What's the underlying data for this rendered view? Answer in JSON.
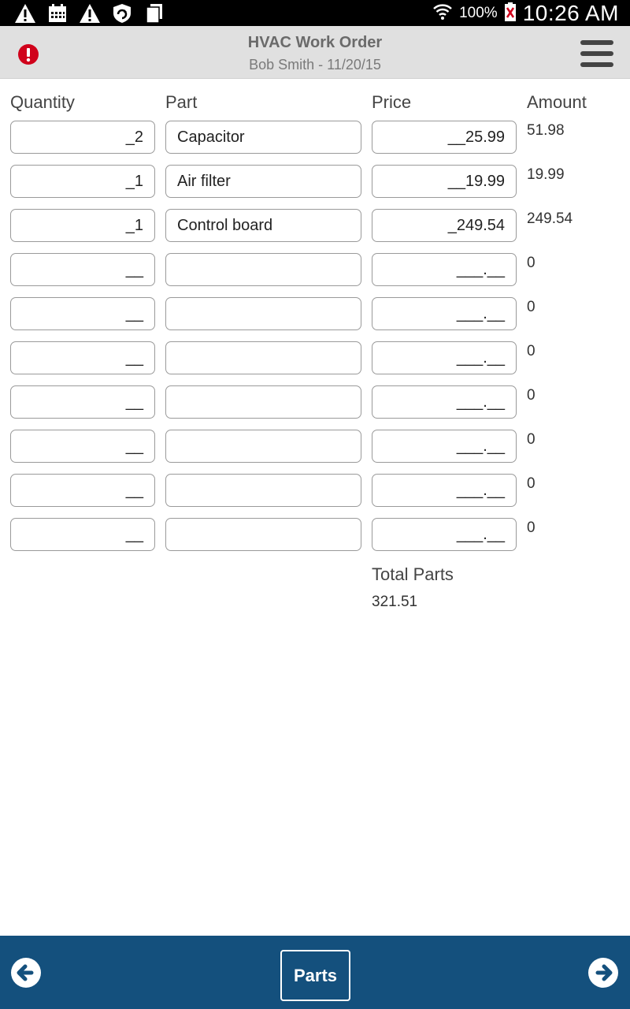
{
  "status_bar": {
    "icons": [
      "warning-icon",
      "calendar-icon",
      "warning-icon",
      "shield-icon",
      "files-icon"
    ],
    "wifi_icon": "wifi-icon",
    "battery_percent": "100%",
    "battery_icon": "battery-icon",
    "time": "10:26 AM"
  },
  "header": {
    "title": "HVAC Work Order",
    "subtitle": "Bob Smith - 11/20/15",
    "alert_icon": "alert-icon",
    "menu_icon": "hamburger-menu-icon"
  },
  "columns": {
    "quantity": "Quantity",
    "part": "Part",
    "price": "Price",
    "amount": "Amount"
  },
  "rows": [
    {
      "quantity": "_2",
      "part": "Capacitor",
      "price": "__25.99",
      "amount": "51.98"
    },
    {
      "quantity": "_1",
      "part": "Air filter",
      "price": "__19.99",
      "amount": "19.99"
    },
    {
      "quantity": "_1",
      "part": "Control board",
      "price": "_249.54",
      "amount": "249.54"
    },
    {
      "quantity": "__",
      "part": "",
      "price": "___.__",
      "amount": "0"
    },
    {
      "quantity": "__",
      "part": "",
      "price": "___.__",
      "amount": "0"
    },
    {
      "quantity": "__",
      "part": "",
      "price": "___.__",
      "amount": "0"
    },
    {
      "quantity": "__",
      "part": "",
      "price": "___.__",
      "amount": "0"
    },
    {
      "quantity": "__",
      "part": "",
      "price": "___.__",
      "amount": "0"
    },
    {
      "quantity": "__",
      "part": "",
      "price": "___.__",
      "amount": "0"
    },
    {
      "quantity": "__",
      "part": "",
      "price": "___.__",
      "amount": "0"
    }
  ],
  "totals": {
    "label": "Total Parts",
    "value": "321.51"
  },
  "bottom_bar": {
    "back_icon": "arrow-left-circle-icon",
    "forward_icon": "arrow-right-circle-icon",
    "parts_label": "Parts"
  },
  "colors": {
    "bottom_bar": "#14507d",
    "header_bg": "#e0e0e0",
    "alert": "#d0021b"
  }
}
